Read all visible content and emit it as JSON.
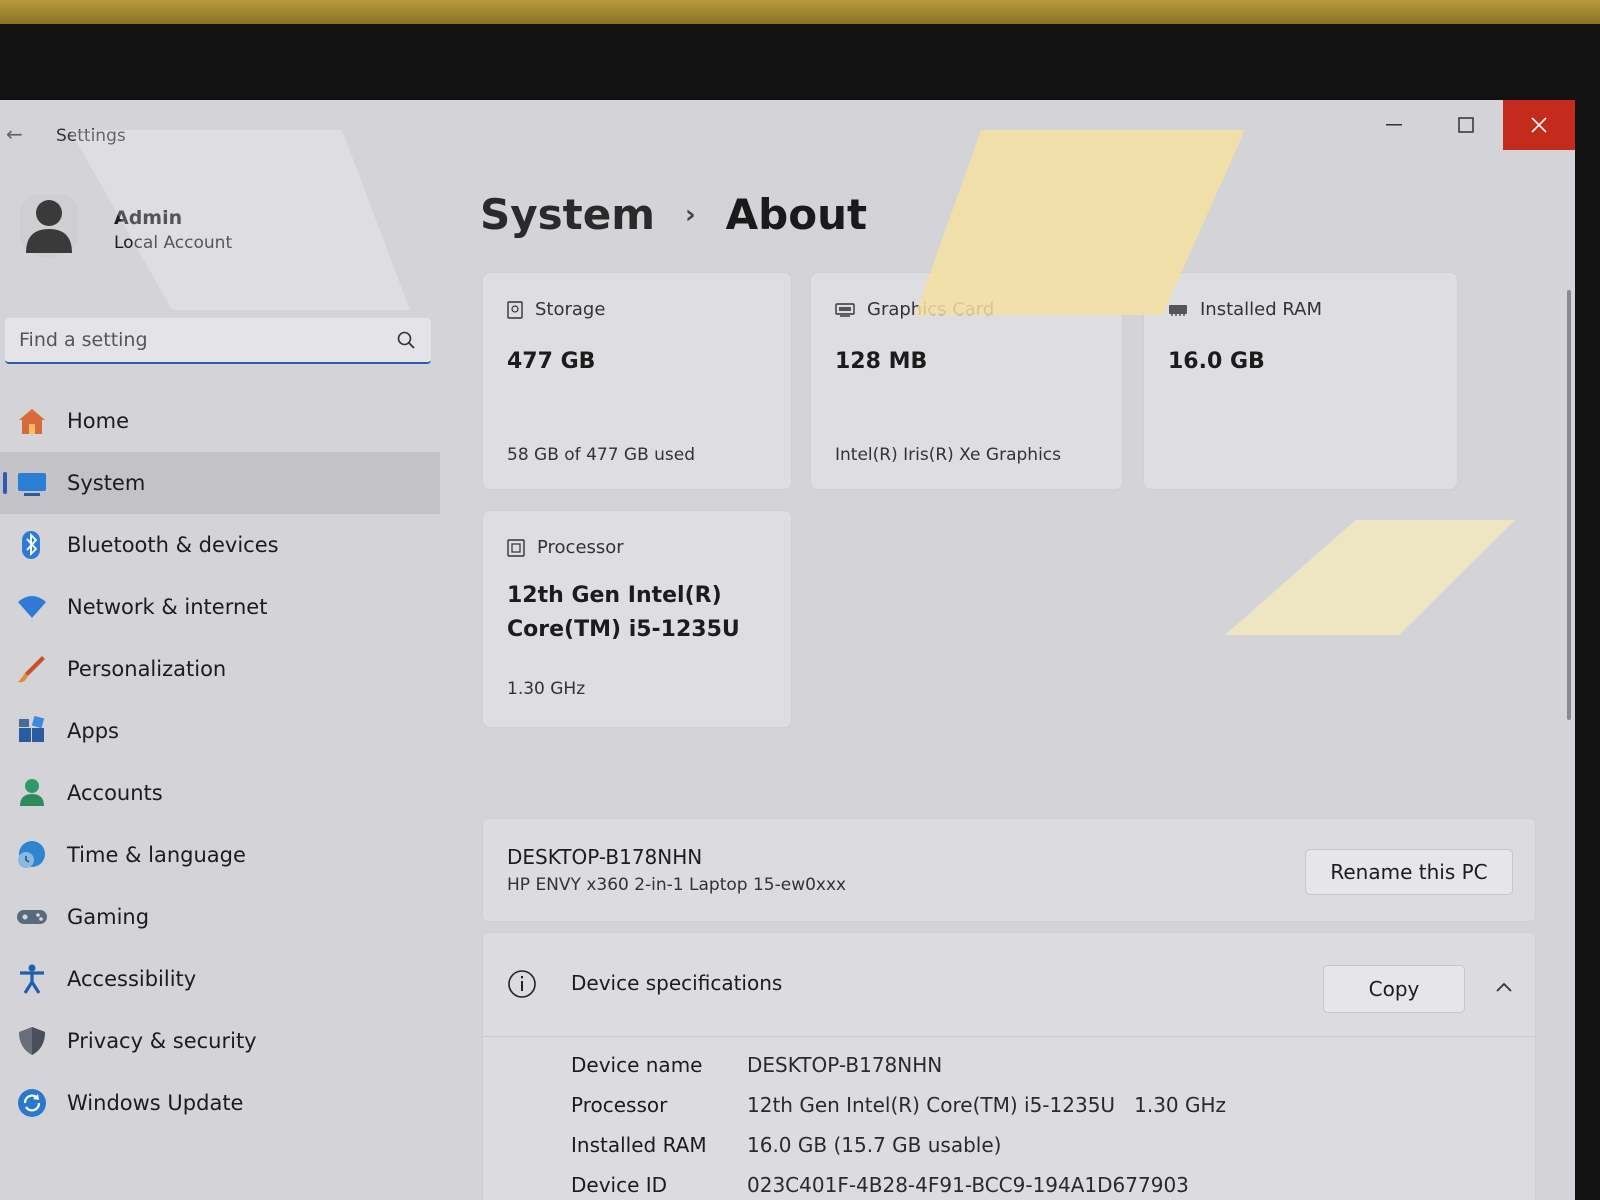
{
  "window": {
    "title": "Settings",
    "back": "←",
    "minimize": "—",
    "maximize": "☐"
  },
  "profile": {
    "name": "Admin",
    "account_type": "Local Account"
  },
  "search": {
    "placeholder": "Find a setting"
  },
  "nav": {
    "items": [
      {
        "label": "Home",
        "icon": "home-icon"
      },
      {
        "label": "System",
        "icon": "system-icon",
        "selected": true
      },
      {
        "label": "Bluetooth & devices",
        "icon": "bluetooth-icon"
      },
      {
        "label": "Network & internet",
        "icon": "wifi-icon"
      },
      {
        "label": "Personalization",
        "icon": "brush-icon"
      },
      {
        "label": "Apps",
        "icon": "apps-icon"
      },
      {
        "label": "Accounts",
        "icon": "person-icon"
      },
      {
        "label": "Time & language",
        "icon": "globe-clock-icon"
      },
      {
        "label": "Gaming",
        "icon": "gamepad-icon"
      },
      {
        "label": "Accessibility",
        "icon": "accessibility-icon"
      },
      {
        "label": "Privacy & security",
        "icon": "shield-icon"
      },
      {
        "label": "Windows Update",
        "icon": "update-icon"
      }
    ]
  },
  "breadcrumb": {
    "parent": "System",
    "separator": "›",
    "current": "About"
  },
  "cards": {
    "storage": {
      "label": "Storage",
      "value": "477 GB",
      "sub": "58 GB of 477 GB used"
    },
    "graphics": {
      "label": "Graphics Card",
      "value": "128 MB",
      "sub": "Intel(R) Iris(R) Xe Graphics"
    },
    "ram": {
      "label": "Installed RAM",
      "value": "16.0 GB"
    },
    "processor": {
      "label": "Processor",
      "value_line1": "12th Gen Intel(R)",
      "value_line2": "Core(TM) i5-1235U",
      "sub": "1.30 GHz"
    }
  },
  "pc": {
    "name": "DESKTOP-B178NHN",
    "model": "HP ENVY x360 2-in-1 Laptop 15-ew0xxx",
    "rename_label": "Rename this PC"
  },
  "specs": {
    "title": "Device specifications",
    "copy_label": "Copy",
    "rows": [
      {
        "label": "Device name",
        "value": "DESKTOP-B178NHN"
      },
      {
        "label": "Processor",
        "value": "12th Gen Intel(R) Core(TM) i5-1235U   1.30 GHz"
      },
      {
        "label": "Installed RAM",
        "value": "16.0 GB (15.7 GB usable)"
      },
      {
        "label": "Device ID",
        "value": "023C401F-4B28-4F91-BCC9-194A1D677903"
      }
    ]
  },
  "colors": {
    "accent": "#2b5cb0",
    "close": "#c42b1c",
    "background": "#d3d3d8"
  }
}
